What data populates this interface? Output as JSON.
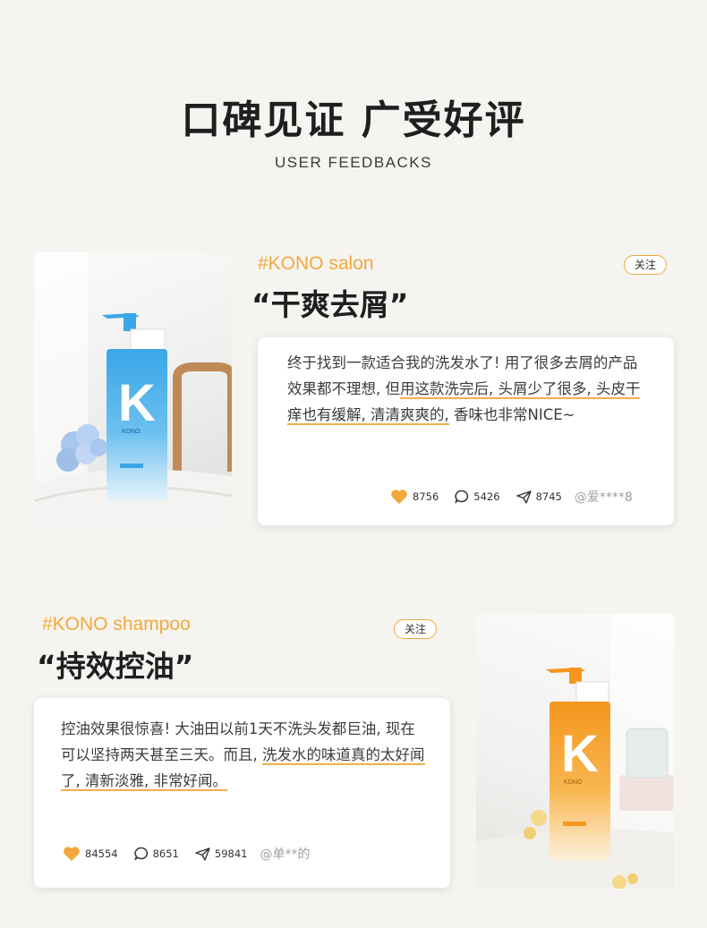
{
  "header": {
    "title": "口碑见证 广受好评",
    "subtitle": "USER FEEDBACKS"
  },
  "reviews": [
    {
      "tag": "#KONO salon",
      "headline": "“干爽去屑”",
      "follow_label": "关注",
      "text_parts": [
        "终于找到一款适合我的洗发水了! 用了很多去屑的产品效果都不理想, 但",
        "用这款洗完后, 头屑少了很多, 头皮干痒也有缓解, 清清爽爽的,",
        " 香味也非常NICE~"
      ],
      "likes": "8756",
      "comments": "5426",
      "shares": "8745",
      "user": "@爱****8",
      "product": {
        "brand": "KONO",
        "letter": "K",
        "color": "#3aa6e8"
      }
    },
    {
      "tag": "#KONO shampoo",
      "headline": "“持效控油”",
      "follow_label": "关注",
      "text_parts": [
        "控油效果很惊喜! 大油田以前1天不洗头发都巨油, 现在可以坚持两天甚至三天。而且, ",
        "洗发水的味道真的太好闻了, 清新淡雅, 非常好闻。",
        ""
      ],
      "likes": "84554",
      "comments": "8651",
      "shares": "59841",
      "user": "@单**的",
      "product": {
        "brand": "KONO",
        "letter": "K",
        "color": "#f5961e"
      }
    }
  ],
  "colors": {
    "accent": "#f2a83a",
    "background": "#f6f4f1"
  }
}
